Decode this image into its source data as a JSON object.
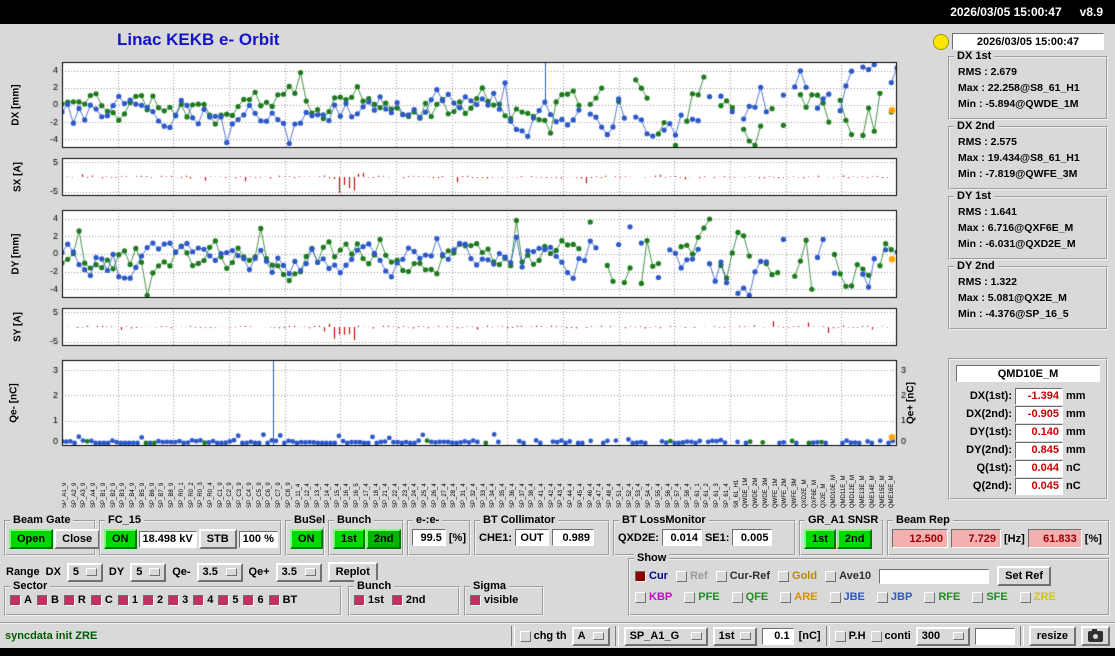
{
  "window": {
    "titlebar_datetime": "2026/03/05 15:00:47",
    "titlebar_version": "v8.9"
  },
  "header": {
    "title": "Linac KEKB e- Orbit",
    "clock": "2026/03/05 15:00:47"
  },
  "stats": [
    {
      "label": "DX 1st",
      "rms": "RMS : 2.679",
      "max": "Max : 22.258@S8_61_H1",
      "min": "Min : -5.894@QWDE_1M"
    },
    {
      "label": "DX 2nd",
      "rms": "RMS : 2.575",
      "max": "Max : 19.434@S8_61_H1",
      "min": "Min : -7.819@QWFE_3M"
    },
    {
      "label": "DY 1st",
      "rms": "RMS : 1.641",
      "max": "Max : 6.716@QXF6E_M",
      "min": "Min : -6.031@QXD2E_M"
    },
    {
      "label": "DY 2nd",
      "rms": "RMS : 1.322",
      "max": "Max : 5.081@QX2E_M",
      "min": "Min : -4.376@SP_16_5"
    }
  ],
  "monitor": {
    "title": "QMD10E_M",
    "rows": [
      {
        "label": "DX(1st):",
        "value": "-1.394",
        "unit": "mm"
      },
      {
        "label": "DX(2nd):",
        "value": "-0.905",
        "unit": "mm"
      },
      {
        "label": "DY(1st):",
        "value": "0.140",
        "unit": "mm"
      },
      {
        "label": "DY(2nd):",
        "value": "0.845",
        "unit": "mm"
      },
      {
        "label": "Q(1st):",
        "value": "0.044",
        "unit": "nC"
      },
      {
        "label": "Q(2nd):",
        "value": "0.045",
        "unit": "nC"
      }
    ]
  },
  "plot_axes": {
    "dx": "DX [mm]",
    "sx": "SX [A]",
    "dy": "DY [mm]",
    "sy": "SY [A]",
    "q_left": "Qe- [nC]",
    "q_right": "Qe+ [nC]"
  },
  "plot_colors": {
    "green": "#1e7a1e",
    "blue": "#2d59c8",
    "red": "#cc1111",
    "orange": "#ffa500"
  },
  "chart_data": [
    {
      "id": "dx",
      "type": "scatter",
      "kind": "orbit",
      "ylabel": "DX [mm]",
      "ylim": [
        -5,
        5
      ],
      "yticks": [
        4,
        2,
        0,
        -2,
        -4
      ],
      "seed": 11,
      "n": 148,
      "spike": 0.578,
      "end": "#ffa500",
      "series": [
        {
          "name": "1st bunch",
          "color": "#1e7a1e"
        },
        {
          "name": "2nd bunch",
          "color": "#2d59c8"
        }
      ],
      "x": "BPM index along linac",
      "note": "orbit deviation, RMS 2.679/2.575 mm, max 22.258@S8_61_H1"
    },
    {
      "id": "sx",
      "type": "bar",
      "kind": "bars",
      "ylabel": "SX [A]",
      "ylim": [
        -6.5,
        6.5
      ],
      "yticks": [
        5,
        -5
      ],
      "seed": 23,
      "n": 170,
      "cluster": 0.345,
      "color": "#cc1111",
      "note": "steering corrector currents, small bars with cluster of large spikes near x=0.35"
    },
    {
      "id": "dy",
      "type": "scatter",
      "kind": "orbit",
      "ylabel": "DY [mm]",
      "ylim": [
        -5,
        5
      ],
      "yticks": [
        4,
        2,
        0,
        -2,
        -4
      ],
      "seed": 47,
      "n": 148,
      "spike": null,
      "end": "#ffa500",
      "series": [
        {
          "name": "1st bunch",
          "color": "#1e7a1e"
        },
        {
          "name": "2nd bunch",
          "color": "#2d59c8"
        }
      ],
      "note": "vertical orbit deviation, RMS 1.641/1.322 mm"
    },
    {
      "id": "sy",
      "type": "bar",
      "kind": "bars",
      "ylabel": "SY [A]",
      "ylim": [
        -6.5,
        6.5
      ],
      "yticks": [
        5,
        -5
      ],
      "seed": 71,
      "n": 170,
      "cluster": 0.33,
      "color": "#cc1111",
      "note": "vertical steering currents"
    },
    {
      "id": "q",
      "type": "scatter",
      "kind": "charge",
      "ylabel": "Qe- [nC]",
      "ylabel_right": "Qe+ [nC]",
      "ylim": [
        0,
        3.4
      ],
      "yticks": [
        3,
        2,
        1,
        0
      ],
      "seed": 5,
      "n": 200,
      "spike": 0.253,
      "end": "#ffa500",
      "right_ticks": true,
      "note": "bunch charge ~0.1 nC along linac with one tall spike at ~25% of width"
    }
  ],
  "bpm_labels": [
    "SP_A1_9",
    "SP_A2_9",
    "SP_A3_9",
    "SP_A4_9",
    "SP_B1_9",
    "SP_B2_9",
    "SP_B3_9",
    "SP_B4_9",
    "SP_B5_9",
    "SP_B6_9",
    "SP_B7_9",
    "SP_B8_9",
    "SP_R0_1",
    "SP_R0_2",
    "SP_R0_3",
    "SP_R0_4",
    "SP_C1_9",
    "SP_C2_9",
    "SP_C3_9",
    "SP_C4_9",
    "SP_C5_9",
    "SP_C6_9",
    "SP_C7_9",
    "SP_C8_9",
    "SP_11_4",
    "SP_12_4",
    "SP_13_4",
    "SP_14_4",
    "SP_15_4",
    "SP_16_4",
    "SP_16_5",
    "SP_17_4",
    "SP_18_4",
    "SP_21_4",
    "SP_22_4",
    "SP_23_4",
    "SP_24_4",
    "SP_25_4",
    "SP_26_4",
    "SP_27_4",
    "SP_28_4",
    "SP_31_4",
    "SP_32_4",
    "SP_33_4",
    "SP_34_4",
    "SP_35_4",
    "SP_36_4",
    "SP_37_4",
    "SP_38_4",
    "SP_41_4",
    "SP_42_4",
    "SP_43_4",
    "SP_44_4",
    "SP_45_4",
    "SP_46_4",
    "SP_47_4",
    "SP_48_4",
    "SP_51_4",
    "SP_52_4",
    "SP_53_4",
    "SP_54_4",
    "SP_55_4",
    "SP_56_4",
    "SP_57_4",
    "SP_58_4",
    "SP_61_1",
    "SP_61_2",
    "SP_61_3",
    "SP_61_4",
    "S8_61_H1",
    "QWDE_1M",
    "QWDE_2M",
    "QWDE_3M",
    "QWFE_1M",
    "QWFE_2M",
    "QWFE_3M",
    "QXD2E_M",
    "QXF6E_M",
    "QX2E_M",
    "QMD10E_M",
    "QMD11E_M",
    "QMD12E_M",
    "QME13E_M",
    "QME14E_M",
    "QME15E_M",
    "QME16E_M"
  ],
  "panels": {
    "beam_gate": {
      "label": "Beam Gate",
      "open": "Open",
      "close": "Close"
    },
    "fc15": {
      "label": "FC_15",
      "on": "ON",
      "kv": "18.498 kV",
      "stb": "STB",
      "duty": "100 %"
    },
    "busel": {
      "label": "BuSel",
      "on": "ON"
    },
    "bunch": {
      "label": "Bunch",
      "first": "1st",
      "second": "2nd"
    },
    "ee": {
      "label": "e-:e-",
      "value": "99.5",
      "unit": "[%]"
    },
    "bt_collimator": {
      "label": "BT Collimator",
      "che1": "CHE1:",
      "out": "OUT",
      "value": "0.989"
    },
    "bt_lossmonitor": {
      "label": "BT LossMonitor",
      "qxd2e": "QXD2E:",
      "v1": "0.014",
      "se1": "SE1:",
      "v2": "0.005"
    },
    "gr_snsr": {
      "label": "GR_A1 SNSR",
      "first": "1st",
      "second": "2nd"
    },
    "beam_rep": {
      "label": "Beam Rep",
      "v1": "12.500",
      "v2": "7.729",
      "hz": "[Hz]",
      "v3": "61.833",
      "pct": "[%]"
    }
  },
  "range_row": {
    "range": "Range",
    "dx": "DX",
    "dx_val": "5",
    "dy": "DY",
    "dy_val": "5",
    "qem": "Qe-",
    "qem_val": "3.5",
    "qep": "Qe+",
    "qep_val": "3.5",
    "replot": "Replot"
  },
  "show": {
    "label": "Show",
    "row1": [
      {
        "label": "Cur",
        "color": "#00008b",
        "checked": true,
        "box": "#8b0000"
      },
      {
        "label": "Ref",
        "color": "#9a9a9a",
        "checked": false
      },
      {
        "label": "Cur-Ref",
        "color": "#303030",
        "checked": false
      },
      {
        "label": "Gold",
        "color": "#b8860b",
        "checked": false
      },
      {
        "label": "Ave10",
        "color": "#303030",
        "checked": false
      }
    ],
    "entry": "",
    "set_ref": "Set Ref",
    "row2": [
      {
        "label": "KBP",
        "color": "#cc00cc",
        "checked": false
      },
      {
        "label": "PFE",
        "color": "#228b22",
        "checked": false
      },
      {
        "label": "QFE",
        "color": "#228b22",
        "checked": false
      },
      {
        "label": "ARE",
        "color": "#d79000",
        "checked": false
      },
      {
        "label": "JBE",
        "color": "#2d59c8",
        "checked": false
      },
      {
        "label": "JBP",
        "color": "#2d59c8",
        "checked": false
      },
      {
        "label": "RFE",
        "color": "#228b22",
        "checked": false
      },
      {
        "label": "SFE",
        "color": "#228b22",
        "checked": false
      },
      {
        "label": "ZRE",
        "color": "#cccc00",
        "checked": false
      }
    ]
  },
  "sector": {
    "label": "Sector",
    "items": [
      "A",
      "B",
      "R",
      "C",
      "1",
      "2",
      "3",
      "4",
      "5",
      "6",
      "BT"
    ],
    "box": "#c03060"
  },
  "bunch2": {
    "label": "Bunch",
    "items": [
      "1st",
      "2nd"
    ],
    "box": "#c03060"
  },
  "sigma": {
    "label": "Sigma",
    "items": [
      "visible"
    ],
    "box": "#c03060"
  },
  "statusbar": {
    "message": "syncdata init ZRE",
    "chg_th": "chg th",
    "dd_a": "A",
    "dd_sp": "SP_A1_G",
    "dd_bunch": "1st",
    "threshold": "0.1",
    "nc": "[nC]",
    "ph": "P.H",
    "conti": "conti",
    "dd_rate": "300",
    "entry2": "",
    "resize": "resize"
  }
}
